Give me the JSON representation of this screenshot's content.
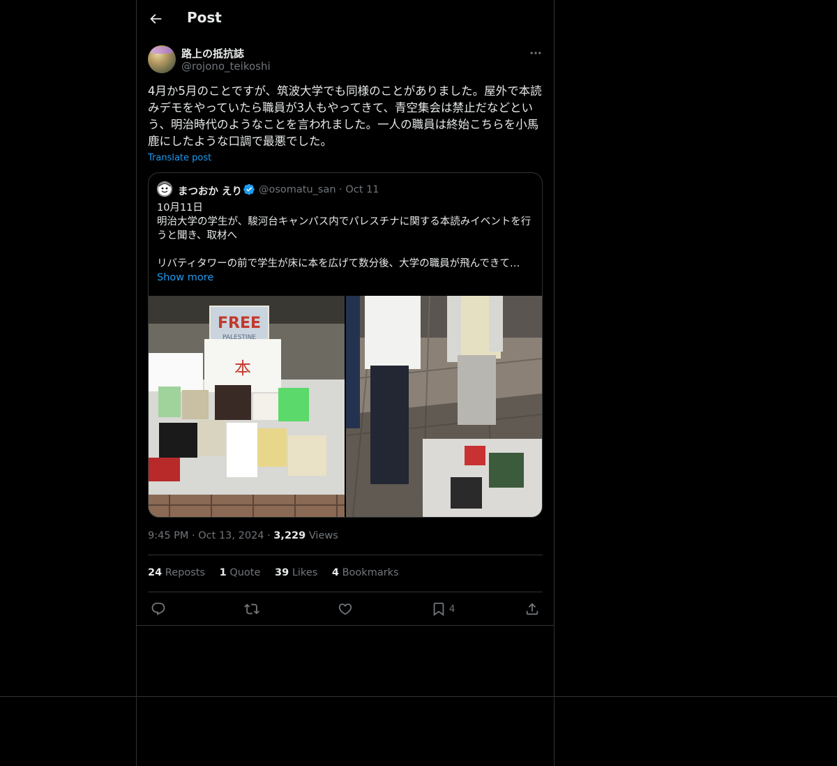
{
  "header": {
    "title": "Post"
  },
  "author": {
    "name": "路上の抵抗誌",
    "handle": "@rojono_teikoshi"
  },
  "post": {
    "text": "4月か5月のことですが、筑波大学でも同様のことがありました。屋外で本読みデモをやっていたら職員が3人もやってきて、青空集会は禁止だなどという、明治時代のようなことを言われました。一人の職員は終始こちらを小馬鹿にしたような口調で最悪でした。",
    "translate_label": "Translate post"
  },
  "quoted": {
    "name": "まつおか えり",
    "handle": "@osomatu_san",
    "date": "Oct 11",
    "line1": "10月11日",
    "line2": "明治大学の学生が、駿河台キャンパス内でパレスチナに関する本読みイベントを行うと聞き、取材へ",
    "line3": "リバティタワーの前で学生が床に本を広げて数分後、大学の職員が飛んできて…",
    "show_more": "Show more"
  },
  "meta": {
    "time": "9:45 PM",
    "date": "Oct 13, 2024",
    "views": "3,229",
    "views_label": "Views"
  },
  "stats": {
    "reposts": "24",
    "reposts_label": "Reposts",
    "quotes": "1",
    "quotes_label": "Quote",
    "likes": "39",
    "likes_label": "Likes",
    "bookmarks": "4",
    "bookmarks_label": "Bookmarks"
  },
  "actions": {
    "bookmark_count": "4"
  },
  "icons": [
    "back-arrow-icon",
    "more-icon",
    "verified-icon",
    "reply-icon",
    "repost-icon",
    "like-icon",
    "bookmark-icon",
    "share-icon"
  ],
  "colors": {
    "background": "#000000",
    "text": "#e7e9ea",
    "muted": "#71767b",
    "accent": "#1d9bf0",
    "border": "#2f3336"
  }
}
